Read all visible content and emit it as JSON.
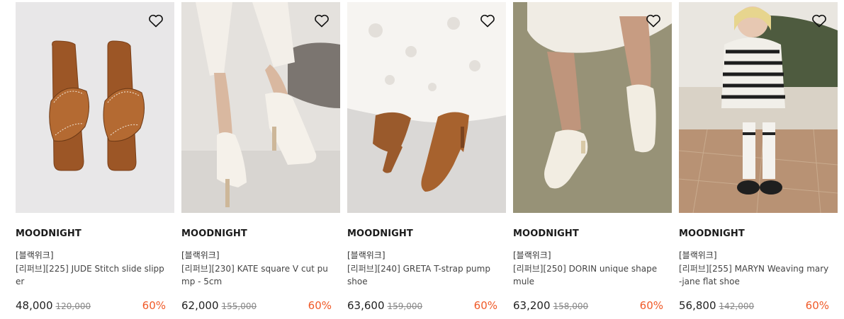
{
  "products": [
    {
      "brand": "MOODNIGHT",
      "tag": "[블랙위크]",
      "title": "[리퍼브][225] JUDE Stitch slide slipper",
      "price": "48,000",
      "original_price": "120,000",
      "discount": "60%"
    },
    {
      "brand": "MOODNIGHT",
      "tag": "[블랙위크]",
      "title": "[리퍼브][230] KATE square V cut pump - 5cm",
      "price": "62,000",
      "original_price": "155,000",
      "discount": "60%"
    },
    {
      "brand": "MOODNIGHT",
      "tag": "[블랙위크]",
      "title": "[리퍼브][240] GRETA T-strap pump shoe",
      "price": "63,600",
      "original_price": "159,000",
      "discount": "60%"
    },
    {
      "brand": "MOODNIGHT",
      "tag": "[블랙위크]",
      "title": "[리퍼브][250] DORIN unique shape mule",
      "price": "63,200",
      "original_price": "158,000",
      "discount": "60%"
    },
    {
      "brand": "MOODNIGHT",
      "tag": "[블랙위크]",
      "title": "[리퍼브][255] MARYN Weaving mary-jane flat shoe",
      "price": "56,800",
      "original_price": "142,000",
      "discount": "60%"
    }
  ],
  "colors": {
    "discount": "#f05a28",
    "price": "#222222",
    "original_price": "#888888"
  },
  "icons": {
    "wishlist": "heart-outline-icon"
  }
}
